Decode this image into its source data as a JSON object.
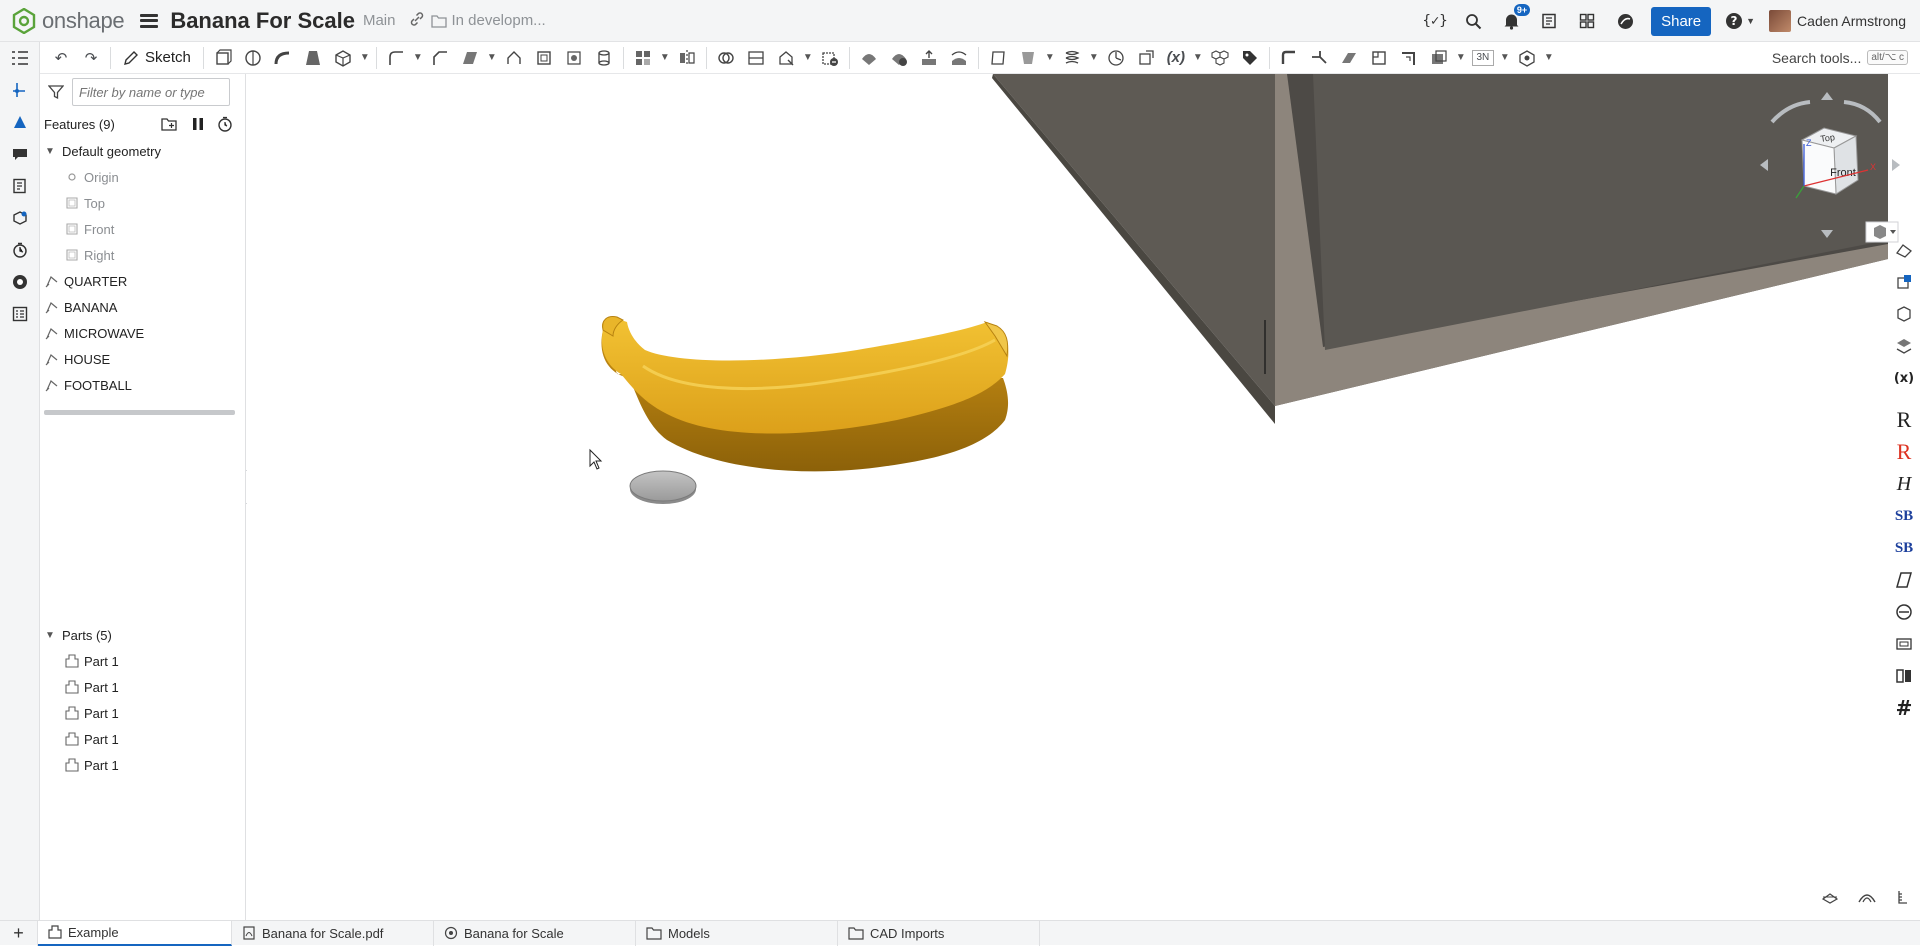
{
  "header": {
    "logo_text": "onshape",
    "doc_title": "Banana For Scale",
    "branch": "Main",
    "folder": "In developm...",
    "notification_count": "9+",
    "share_label": "Share",
    "user_name": "Caden Armstrong"
  },
  "toolbar": {
    "sketch_label": "Sketch",
    "search_label": "Search tools...",
    "search_shortcut": "alt/⌥ c",
    "mate_count": "3N"
  },
  "features": {
    "filter_placeholder": "Filter by name or type",
    "header": "Features (9)",
    "default_geometry": "Default geometry",
    "geometry_items": [
      "Origin",
      "Top",
      "Front",
      "Right"
    ],
    "items": [
      "QUARTER",
      "BANANA",
      "MICROWAVE",
      "HOUSE",
      "FOOTBALL"
    ]
  },
  "parts": {
    "header": "Parts (5)",
    "items": [
      "Part 1",
      "Part 1",
      "Part 1",
      "Part 1",
      "Part 1"
    ]
  },
  "viewcube": {
    "top_label": "Top",
    "front_label": "Front",
    "axis_x": "X",
    "axis_z": "Z"
  },
  "tabs": [
    {
      "label": "Example",
      "icon": "part-studio-icon",
      "active": true
    },
    {
      "label": "Banana for Scale.pdf",
      "icon": "pdf-icon",
      "active": false
    },
    {
      "label": "Banana for Scale",
      "icon": "assembly-icon",
      "active": false
    },
    {
      "label": "Models",
      "icon": "folder-icon",
      "active": false
    },
    {
      "label": "CAD Imports",
      "icon": "folder-icon",
      "active": false
    }
  ],
  "colors": {
    "accent": "#1565c0",
    "banana": "#e0a61a",
    "microwave": "#6b6760",
    "quarter": "#b8b8b8"
  }
}
